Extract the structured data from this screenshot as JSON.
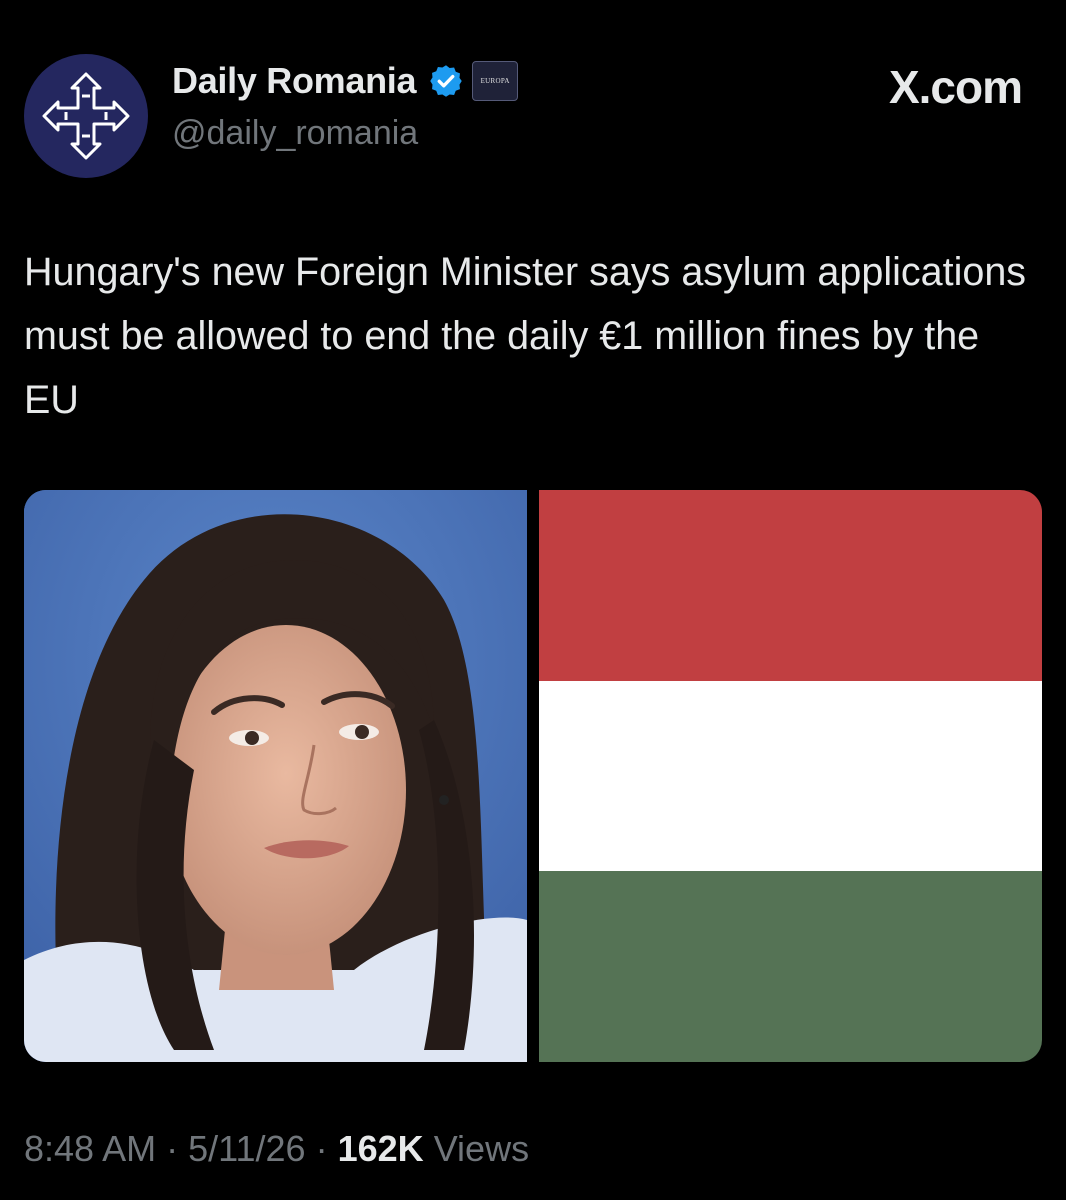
{
  "post": {
    "display_name": "Daily Romania",
    "handle": "@daily_romania",
    "verified_icon": "verified-badge-icon",
    "affiliation_badge": "EUROPA",
    "text": "Hungary's new Foreign Minister says asylum applications must be allowed to end the daily €1 million fines by the EU",
    "time": "8:48 AM",
    "separator": "·",
    "date": "5/11/26",
    "views_count": "162K",
    "views_label": "Views"
  },
  "watermark": "X.com",
  "colors": {
    "background": "#000000",
    "text": "#e7e9ea",
    "muted": "#71767b",
    "verified": "#1d9bf0",
    "avatar_bg": "#24275f",
    "flag_red": "#c13f41",
    "flag_white": "#ffffff",
    "flag_green": "#557355"
  },
  "media": {
    "photo_icon": "portrait-photo",
    "flag_icon": "hungarian-flag"
  }
}
